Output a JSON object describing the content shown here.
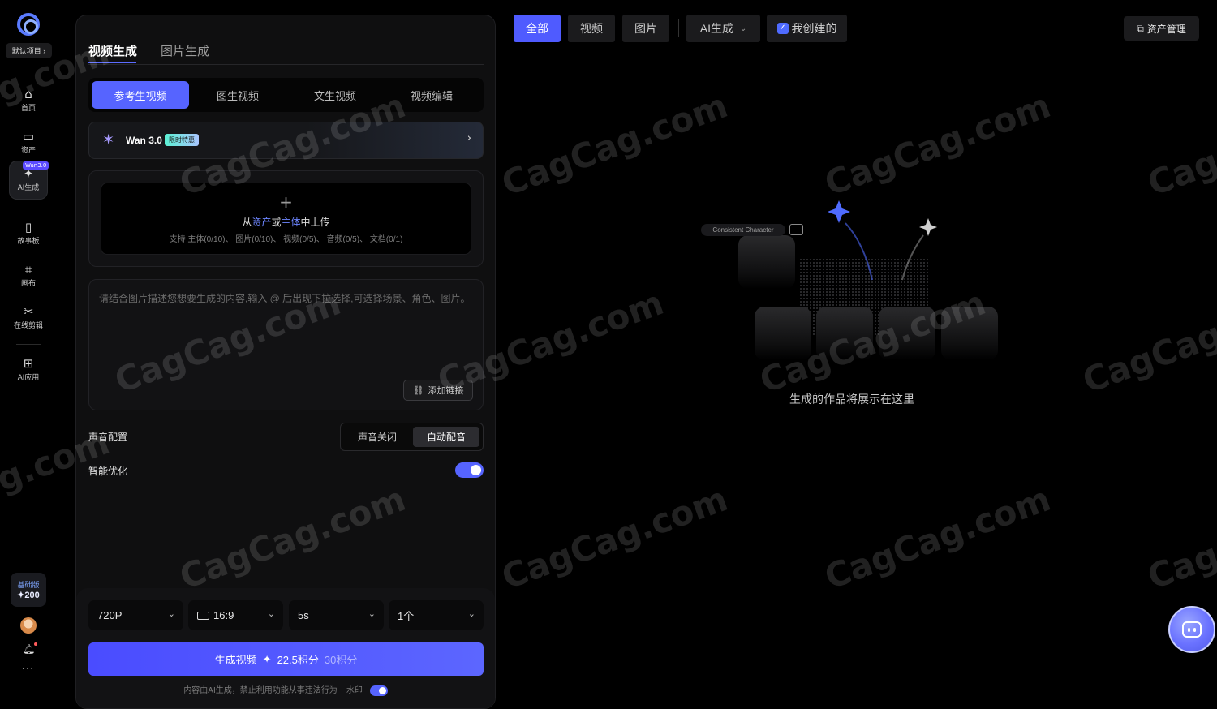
{
  "sidebar": {
    "project_label": "默认项目",
    "items": [
      {
        "label": "首页",
        "icon": "home-icon"
      },
      {
        "label": "资产",
        "icon": "folder-icon"
      },
      {
        "label": "AI生成",
        "icon": "sparkle-icon",
        "badge": "Wan3.0"
      },
      {
        "label": "故事板",
        "icon": "book-icon"
      },
      {
        "label": "画布",
        "icon": "canvas-icon"
      },
      {
        "label": "在线剪辑",
        "icon": "edit-icon"
      },
      {
        "label": "AI应用",
        "icon": "apps-icon"
      }
    ],
    "plan_name": "基础版",
    "credits": "200"
  },
  "panel": {
    "tabs": [
      "视频生成",
      "图片生成"
    ],
    "modes": [
      "参考生视频",
      "图生视频",
      "文生视频",
      "视频编辑"
    ],
    "model": {
      "name": "Wan 3.0",
      "badge": "限时特惠"
    },
    "upload": {
      "pre": "从",
      "assets_link": "资产",
      "mid": "或",
      "subject_link": "主体",
      "post": "中上传",
      "support": "支持 主体(0/10)、 图片(0/10)、 视频(0/5)、 音频(0/5)、 文档(0/1)"
    },
    "prompt": {
      "placeholder": "请结合图片描述您想要生成的内容,输入 @ 后出现下拉选择,可选择场景、角色、图片。",
      "add_link": "添加链接"
    },
    "audio": {
      "label": "声音配置",
      "options": [
        "声音关闭",
        "自动配音"
      ],
      "selected": "自动配音"
    },
    "smart": {
      "label": "智能优化",
      "enabled": true
    },
    "settings": {
      "resolution": "720P",
      "ratio": "16:9",
      "duration": "5s",
      "count": "1个"
    },
    "generate": {
      "label": "生成视频",
      "price": "22.5积分",
      "original_price": "30积分"
    },
    "footer": {
      "disclaimer": "内容由AI生成，禁止利用功能从事违法行为",
      "watermark_label": "水印",
      "watermark_on": true
    }
  },
  "topbar": {
    "filters": [
      "全部",
      "视频",
      "图片"
    ],
    "active_filter": "全部",
    "ai_dropdown": "AI生成",
    "mine_checkbox": "我创建的",
    "mine_checked": true,
    "asset_button": "资产管理"
  },
  "empty": {
    "pill_text": "Consistent Character",
    "message": "生成的作品将展示在这里"
  },
  "watermark_text": "CagCag.com",
  "colors": {
    "accent": "#5664ff",
    "background": "#000000",
    "panel": "#0f0f10"
  }
}
